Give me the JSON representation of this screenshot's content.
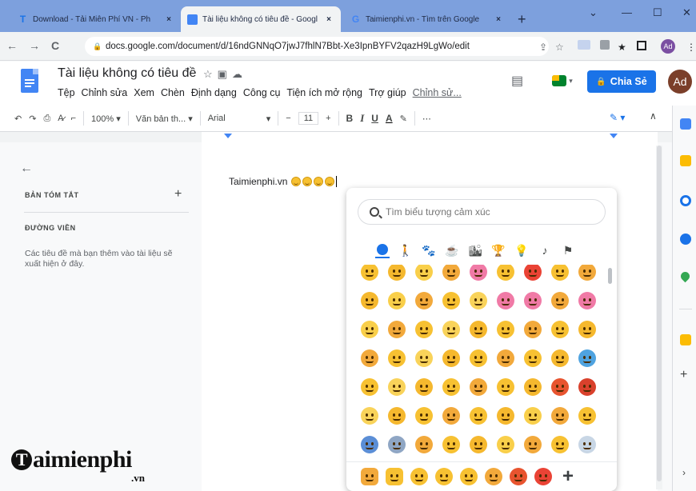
{
  "browser": {
    "tabs": [
      {
        "title": "Download - Tải Miễn Phí VN - Ph",
        "favicon": "T",
        "favicon_color": "#1a73e8",
        "active": false
      },
      {
        "title": "Tài liệu không có tiêu đề - Googl",
        "favicon": "docs-icon",
        "favicon_color": "#4285f4",
        "active": true
      },
      {
        "title": "Taimienphi.vn - Tìm trên Google",
        "favicon": "G",
        "favicon_color": "#ea4335",
        "active": false
      }
    ],
    "tab_close": "×",
    "new_tab": "+",
    "window": {
      "chevron": "⌄",
      "minimize": "—",
      "maximize": "☐",
      "close": "✕"
    },
    "nav": {
      "back": "←",
      "forward": "→",
      "reload": "C"
    },
    "url": "docs.google.com/document/d/16ndGNNqO7jwJ7fhlN7Bbt-Xe3IpnBYFV2qazH9LgWo/edit",
    "profile_initials": "Ad"
  },
  "docs": {
    "title": "Tài liệu không có tiêu đề",
    "menus": [
      "Tệp",
      "Chỉnh sửa",
      "Xem",
      "Chèn",
      "Định dạng",
      "Công cụ",
      "Tiện ích mở rộng",
      "Trợ giúp",
      "Chỉnh sử..."
    ],
    "share_label": "Chia Sẻ",
    "avatar_initials": "Ad",
    "accent": "#1a73e8"
  },
  "toolbar": {
    "zoom": "100%",
    "style": "Văn bản th...",
    "font": "Arial",
    "font_size": "11",
    "minus": "−",
    "plus": "+",
    "bold": "B",
    "italic": "I",
    "underline": "U",
    "text_color": "A",
    "more": "⋯"
  },
  "outline": {
    "summary_title": "BẢN TÓM TẮT",
    "summary_add": "+",
    "headings_title": "ĐƯỜNG VIỀN",
    "hint": "Các tiêu đề mà bạn thêm vào tài liệu sẽ xuất hiện ở đây."
  },
  "document": {
    "text": "Taimienphi.vn",
    "emoji_count": 4
  },
  "emoji_picker": {
    "search_placeholder": "Tìm biểu tượng cảm xúc",
    "categories": [
      "smileys-icon",
      "people-icon",
      "animals-icon",
      "food-icon",
      "travel-icon",
      "activities-icon",
      "objects-icon",
      "symbols-icon",
      "flags-icon"
    ],
    "recent_add": "+"
  },
  "watermark": {
    "brand": "aimienphi",
    "suffix": ".vn"
  }
}
